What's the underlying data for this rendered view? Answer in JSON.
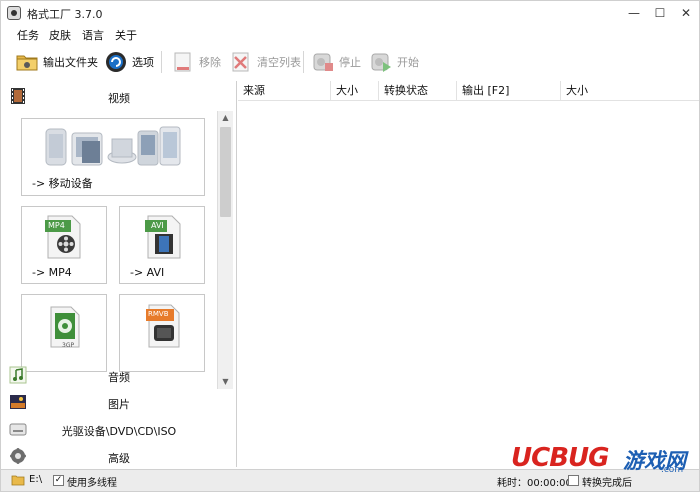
{
  "window": {
    "title": "格式工厂 3.7.0",
    "minimize": "—",
    "maximize": "☐",
    "close": "✕"
  },
  "menu": [
    "任务",
    "皮肤",
    "语言",
    "关于"
  ],
  "toolbar": {
    "output_folder": "输出文件夹",
    "options": "选项",
    "remove": "移除",
    "clear_list": "清空列表",
    "stop": "停止",
    "start": "开始"
  },
  "left_panel": {
    "video": "视频",
    "tiles": {
      "mobile": "-> 移动设备",
      "mp4": "-> MP4",
      "mp4_badge": "MP4",
      "avi": "-> AVI",
      "avi_badge": "AVI",
      "gp3_badge": "3GP",
      "rmvb_badge": "RMVB"
    },
    "audio": "音频",
    "picture": "图片",
    "disc": "光驱设备\\DVD\\CD\\ISO",
    "advanced": "高级"
  },
  "table": {
    "columns": [
      "来源",
      "大小",
      "转换状态",
      "输出 [F2]",
      "大小"
    ]
  },
  "status": {
    "drive": "E:\\",
    "multithread": "使用多线程",
    "elapsed": "耗时：00:00:00",
    "after_convert": "转换完成后"
  },
  "watermark": {
    "brand": "UCBUG",
    "suffix": "游戏网",
    "site": ".com"
  },
  "colors": {
    "accent_blue": "#1a6fc7",
    "watermark_red": "#d9241f",
    "watermark_blue": "#1d5fb3"
  }
}
